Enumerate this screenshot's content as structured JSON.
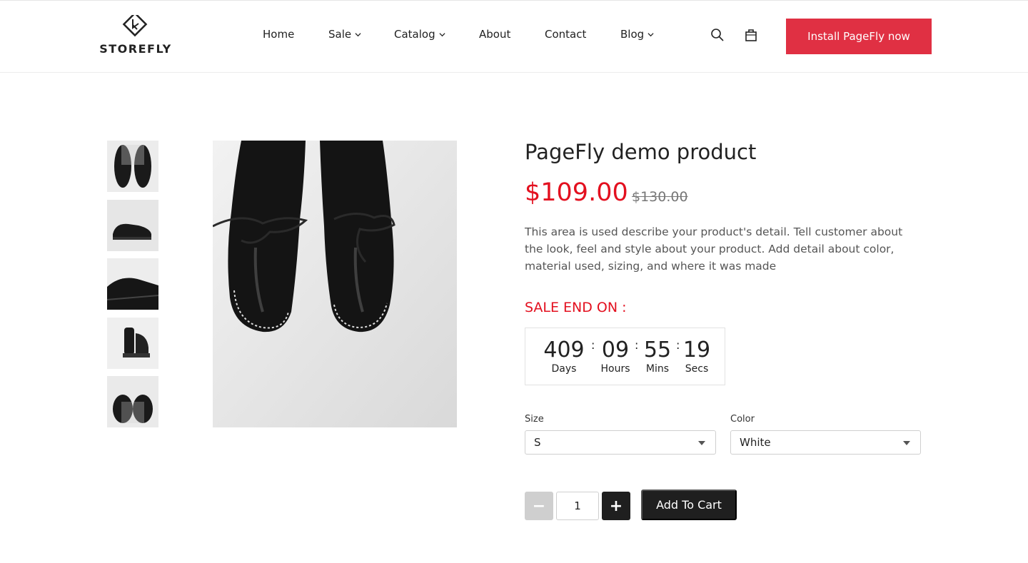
{
  "brand": {
    "name": "STOREFLY"
  },
  "nav": {
    "items": [
      {
        "label": "Home",
        "dropdown": false
      },
      {
        "label": "Sale",
        "dropdown": true
      },
      {
        "label": "Catalog",
        "dropdown": true
      },
      {
        "label": "About",
        "dropdown": false
      },
      {
        "label": "Contact",
        "dropdown": false
      },
      {
        "label": "Blog",
        "dropdown": true
      }
    ],
    "install_label": "Install PageFly now"
  },
  "icons": {
    "search": "search-icon",
    "cart": "shopping-bag-icon",
    "chevron": "chevron-down-icon"
  },
  "gallery": {
    "thumbnails": [
      "shoes-top-view",
      "shoe-side-view",
      "shoes-angled-view",
      "shoes-back-view",
      "shoes-front-view"
    ],
    "main_image": "shoes-top-view"
  },
  "product": {
    "title": "PageFly demo product",
    "price": "$109.00",
    "compare_price": "$130.00",
    "description": "This area is used describe your product's detail. Tell customer about the look, feel and style about your product. Add detail about color, material used, sizing, and where it was made"
  },
  "countdown": {
    "label": "SALE END ON :",
    "days": "409",
    "days_label": "Days",
    "hours": "09",
    "hours_label": "Hours",
    "mins": "55",
    "mins_label": "Mins",
    "secs": "19",
    "secs_label": "Secs",
    "separator": ":"
  },
  "options": {
    "size_label": "Size",
    "size_value": "S",
    "color_label": "Color",
    "color_value": "White"
  },
  "cart": {
    "minus": "−",
    "plus": "+",
    "quantity": "1",
    "add_label": "Add To Cart"
  },
  "colors": {
    "accent_red": "#e3101f",
    "button_red": "#e03043",
    "dark": "#1f1f1f"
  }
}
